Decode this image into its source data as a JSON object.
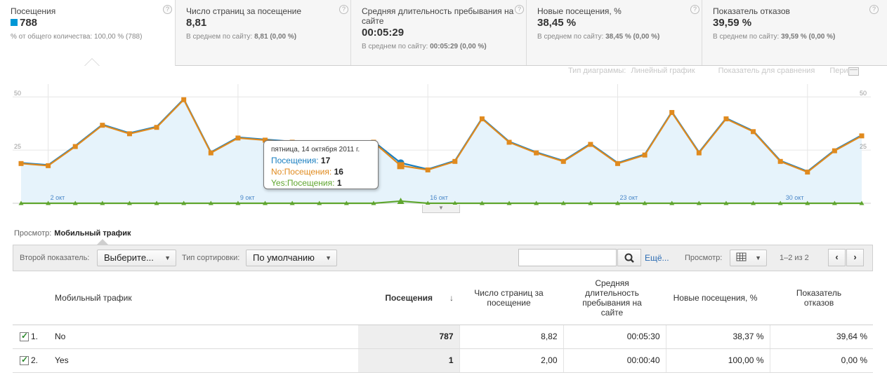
{
  "tabs": [
    {
      "title": "Посещения",
      "value": "788",
      "sub": "% от общего количества: 100,00 % (788)",
      "sub_bold": ""
    },
    {
      "title": "Число страниц за посещение",
      "value": "8,81",
      "sub": "В среднем по сайту: ",
      "sub_bold": "8,81 (0,00 %)"
    },
    {
      "title": "Средняя длительность пребывания на сайте",
      "value": "00:05:29",
      "sub": "В среднем по сайту: ",
      "sub_bold": "00:05:29 (0,00 %)"
    },
    {
      "title": "Новые посещения, %",
      "value": "38,45 %",
      "sub": "В среднем по сайту: ",
      "sub_bold": "38,45 % (0,00 %)"
    },
    {
      "title": "Показатель отказов",
      "value": "39,59 %",
      "sub": "В среднем по сайту: ",
      "sub_bold": "39,59 % (0,00 %)"
    }
  ],
  "help_glyph": "?",
  "chart_options": {
    "type_label": "Тип диаграммы:",
    "type_value": "Линейный график",
    "compare": "Показатель для сравнения",
    "period": "Период:"
  },
  "chart_data": {
    "type": "line",
    "x_labels": [
      "2 окт",
      "9 окт",
      "16 окт",
      "23 окт",
      "30 окт"
    ],
    "y_ticks": [
      "50",
      "25"
    ],
    "ylim": [
      0,
      56
    ],
    "series": [
      {
        "name": "Посещения",
        "color": "#1a7fc0",
        "values": [
          19,
          18,
          27,
          37,
          33,
          36,
          49,
          24,
          31,
          30,
          29,
          28,
          27,
          29,
          19,
          16,
          20,
          40,
          29,
          24,
          20,
          28,
          19,
          23,
          43,
          24,
          40,
          34,
          20,
          15,
          25,
          32
        ]
      },
      {
        "name": "No:Посещения",
        "color": "#e08a1e",
        "values": [
          19,
          18,
          27,
          37,
          33,
          36,
          49,
          24,
          31,
          30,
          29,
          28,
          27,
          29,
          18,
          16,
          20,
          40,
          29,
          24,
          20,
          28,
          19,
          23,
          43,
          24,
          40,
          34,
          20,
          15,
          25,
          32
        ]
      },
      {
        "name": "Yes:Посещения",
        "color": "#5fa52e",
        "values": [
          0,
          0,
          0,
          0,
          0,
          0,
          0,
          0,
          0,
          0,
          0,
          0,
          0,
          0,
          1,
          0,
          0,
          0,
          0,
          0,
          0,
          0,
          0,
          0,
          0,
          0,
          0,
          0,
          0,
          0,
          0,
          0
        ]
      }
    ],
    "highlight_index": 14
  },
  "tooltip": {
    "date": "пятница, 14 октября 2011 г.",
    "l1_label": "Посещения:",
    "l1_value": "17",
    "l2_label": "No:Посещения:",
    "l2_value": "16",
    "l3_label": "Yes:Посещения:",
    "l3_value": "1"
  },
  "view": {
    "label": "Просмотр:",
    "value": "Мобильный трафик"
  },
  "toolbar": {
    "secondary_label": "Второй показатель:",
    "secondary_value": "Выберите...",
    "sort_label": "Тип сортировки:",
    "sort_value": "По умолчанию",
    "search_placeholder": "",
    "more": "Ещё...",
    "view_label": "Просмотр:",
    "pager": "1–2 из 2",
    "prev": "‹",
    "next": "›"
  },
  "table": {
    "headers": {
      "name": "Мобильный трафик",
      "visits": "Посещения",
      "sort_glyph": "↓",
      "pages": "Число страниц за посещение",
      "duration": "Средняя длительность пребывания на сайте",
      "new": "Новые посещения, %",
      "bounce": "Показатель отказов"
    },
    "rows": [
      {
        "num": "1.",
        "name": "No",
        "visits": "787",
        "pages": "8,82",
        "duration": "00:05:30",
        "new": "38,37 %",
        "bounce": "39,64 %"
      },
      {
        "num": "2.",
        "name": "Yes",
        "visits": "1",
        "pages": "2,00",
        "duration": "00:00:40",
        "new": "100,00 %",
        "bounce": "0,00 %"
      }
    ]
  }
}
